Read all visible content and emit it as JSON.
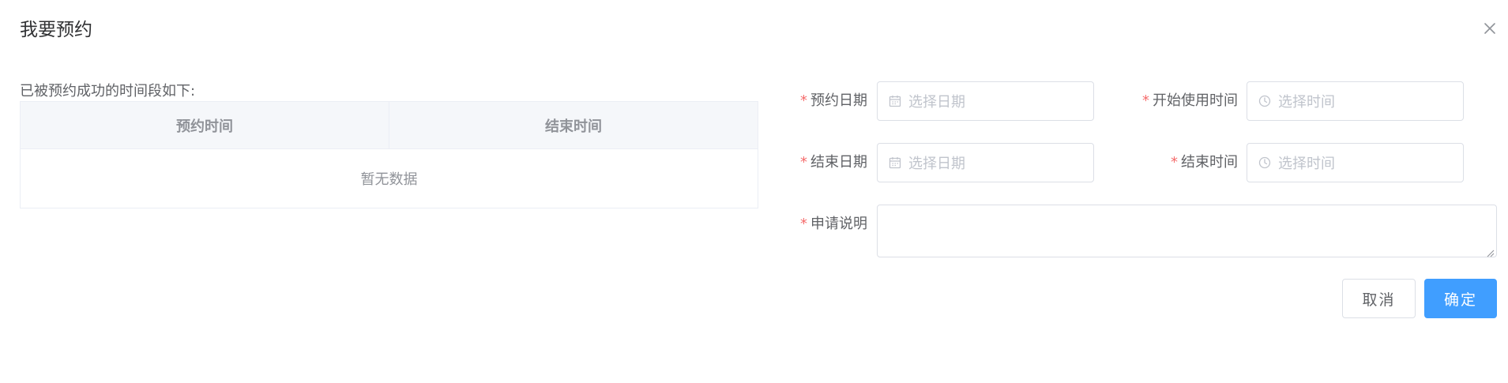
{
  "dialog": {
    "title": "我要预约",
    "close_icon": "close-icon"
  },
  "booked": {
    "caption": "已被预约成功的时间段如下:",
    "columns": [
      "预约时间",
      "结束时间"
    ],
    "empty_text": "暂无数据"
  },
  "form": {
    "required_mark": "*",
    "start_date": {
      "label": "预约日期",
      "placeholder": "选择日期",
      "icon": "calendar-icon"
    },
    "start_time": {
      "label": "开始使用时间",
      "placeholder": "选择时间",
      "icon": "clock-icon"
    },
    "end_date": {
      "label": "结束日期",
      "placeholder": "选择日期",
      "icon": "calendar-icon"
    },
    "end_time": {
      "label": "结束时间",
      "placeholder": "选择时间",
      "icon": "clock-icon"
    },
    "description": {
      "label": "申请说明",
      "value": ""
    }
  },
  "actions": {
    "cancel_label": "取消",
    "confirm_label": "确定"
  },
  "colors": {
    "primary": "#409eff",
    "required": "#f56c6c",
    "placeholder": "#c0c4cc",
    "border": "#dcdfe6"
  }
}
